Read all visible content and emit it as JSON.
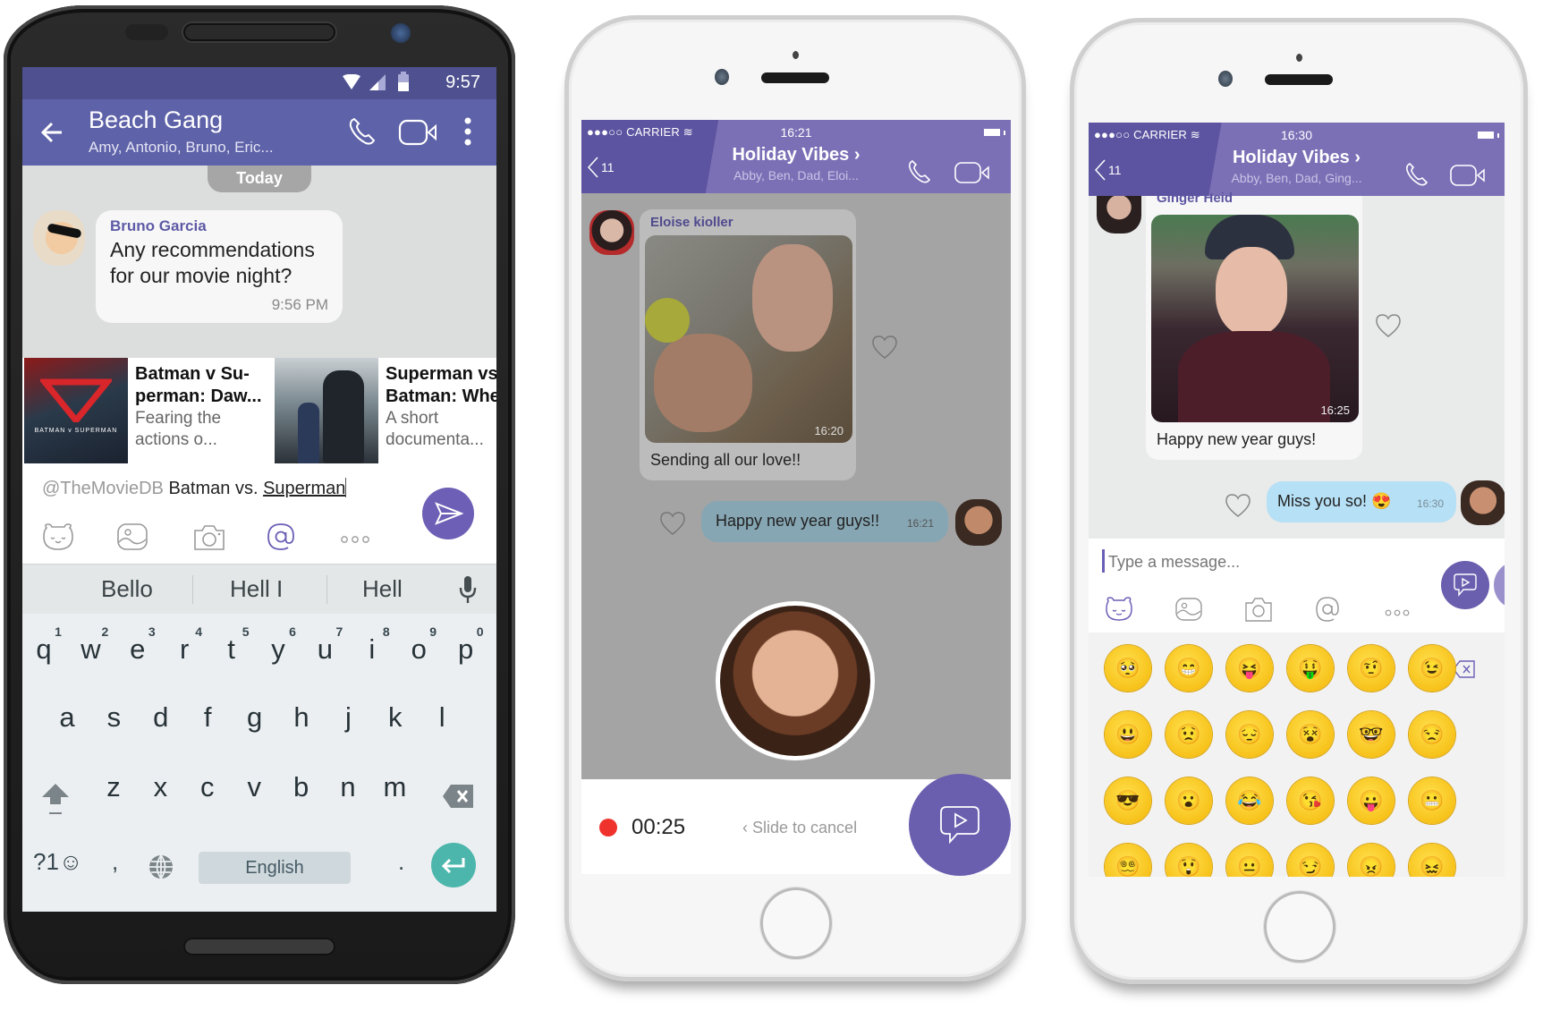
{
  "android": {
    "status_time": "9:57",
    "chat_title": "Beach Gang",
    "chat_members": "Amy, Antonio, Bruno, Eric...",
    "date_pill": "Today",
    "message": {
      "sender": "Bruno Garcia",
      "text": "Any recommendations for our movie night?",
      "time": "9:56 PM"
    },
    "movie_cards": [
      {
        "title": "Batman v Superman: Daw...",
        "title_line1": "Batman v Su-",
        "title_line2": "perman: Daw...",
        "desc_line1": "Fearing the",
        "desc_line2": "actions o...",
        "poster_caption": "BATMAN v SUPERMAN"
      },
      {
        "title": "Superman vs Batman: Whe...",
        "title_line1": "Superman vs",
        "title_line2": "Batman: Whe",
        "desc_line1": "A short",
        "desc_line2": "documenta..."
      }
    ],
    "input": {
      "mention": "@TheMovieDB",
      "text_plain": "Batman vs.",
      "text_underlined": "Superman"
    },
    "toolbar_icons": [
      "sticker-icon",
      "gallery-icon",
      "camera-icon",
      "mention-icon",
      "more-icon"
    ],
    "suggestions": [
      "Bello",
      "Hell I",
      "Hell"
    ],
    "keyboard": {
      "row1": [
        "q",
        "w",
        "e",
        "r",
        "t",
        "y",
        "u",
        "i",
        "o",
        "p"
      ],
      "row1_numbers": [
        "1",
        "2",
        "3",
        "4",
        "5",
        "6",
        "7",
        "8",
        "9",
        "0"
      ],
      "row2": [
        "a",
        "s",
        "d",
        "f",
        "g",
        "h",
        "j",
        "k",
        "l"
      ],
      "row3": [
        "z",
        "x",
        "c",
        "v",
        "b",
        "n",
        "m"
      ],
      "symbols_key": "?1☺",
      "comma_key": ",",
      "period_key": ".",
      "space_label": "English"
    },
    "accent_color": "#5e62a8",
    "send_color": "#6c5fb5",
    "enter_color": "#4db6ac"
  },
  "iphone_recording": {
    "carrier": "●●●○○ CARRIER",
    "time": "16:21",
    "back_count": "11",
    "chat_title": "Holiday Vibes ›",
    "chat_members": "Abby, Ben, Dad, Eloi...",
    "incoming": {
      "sender": "Eloise kioller",
      "photo_time": "16:20",
      "caption": "Sending all our love!!"
    },
    "outgoing": {
      "text": "Happy new year guys!!",
      "time": "16:21"
    },
    "recording": {
      "timer": "00:25",
      "slide_hint": "Slide to cancel",
      "progress": 0.05
    }
  },
  "iphone_emoji": {
    "carrier": "●●●○○ CARRIER",
    "time": "16:30",
    "back_count": "11",
    "chat_title": "Holiday Vibes ›",
    "chat_members": "Abby, Ben, Dad, Ging...",
    "incoming": {
      "sender": "Ginger Heid",
      "photo_time": "16:25",
      "caption": "Happy new year guys!"
    },
    "outgoing": {
      "text": "Miss you so! 😍",
      "time": "16:30"
    },
    "input_placeholder": "Type a message...",
    "toolbar_icons": [
      "sticker-icon",
      "gallery-icon",
      "camera-icon",
      "mention-icon",
      "more-icon"
    ],
    "emoji_rows": [
      [
        "🥺",
        "😁",
        "😝",
        "🤑",
        "🤨",
        "😉"
      ],
      [
        "😃",
        "😟",
        "😔",
        "😵",
        "🤓",
        "😒"
      ],
      [
        "😎",
        "😮",
        "😂",
        "😘",
        "😛",
        "😬"
      ],
      [
        "😵‍💫",
        "😲",
        "😐",
        "😏",
        "😠",
        "😖"
      ]
    ]
  }
}
